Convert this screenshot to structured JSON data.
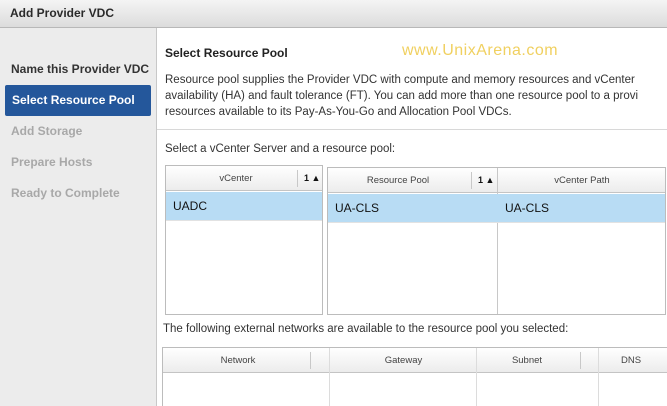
{
  "window": {
    "title": "Add Provider VDC"
  },
  "steps": [
    {
      "label": "Name this Provider VDC",
      "state": "done"
    },
    {
      "label": "Select Resource Pool",
      "state": "active"
    },
    {
      "label": "Add Storage",
      "state": "disabled"
    },
    {
      "label": "Prepare Hosts",
      "state": "disabled"
    },
    {
      "label": "Ready to Complete",
      "state": "disabled"
    }
  ],
  "content": {
    "title": "Select Resource Pool",
    "watermark": "www.UnixArena.com",
    "description": [
      "Resource pool supplies the Provider VDC with compute and memory resources and vCenter",
      "availability (HA) and fault tolerance (FT). You can add more than one resource pool to a provi",
      "resources available to its Pay-As-You-Go and Allocation Pool VDCs."
    ],
    "select_prompt": "Select a vCenter Server and a resource pool:",
    "networks_prompt": "The following external networks are available to the resource pool you selected:"
  },
  "vcenter_grid": {
    "header": "vCenter",
    "sort": "1 ▲",
    "rows": [
      "UADC"
    ]
  },
  "pool_grid": {
    "headers": [
      "Resource Pool",
      "vCenter Path"
    ],
    "sort": "1 ▲",
    "rows": [
      {
        "pool": "UA-CLS",
        "path": "UA-CLS"
      }
    ]
  },
  "network_grid": {
    "headers": [
      "Network",
      "Gateway",
      "Subnet",
      "DNS"
    ]
  },
  "colors": {
    "accent": "#24579b",
    "selection": "#b8dcf4",
    "watermark": "#f0d060"
  }
}
